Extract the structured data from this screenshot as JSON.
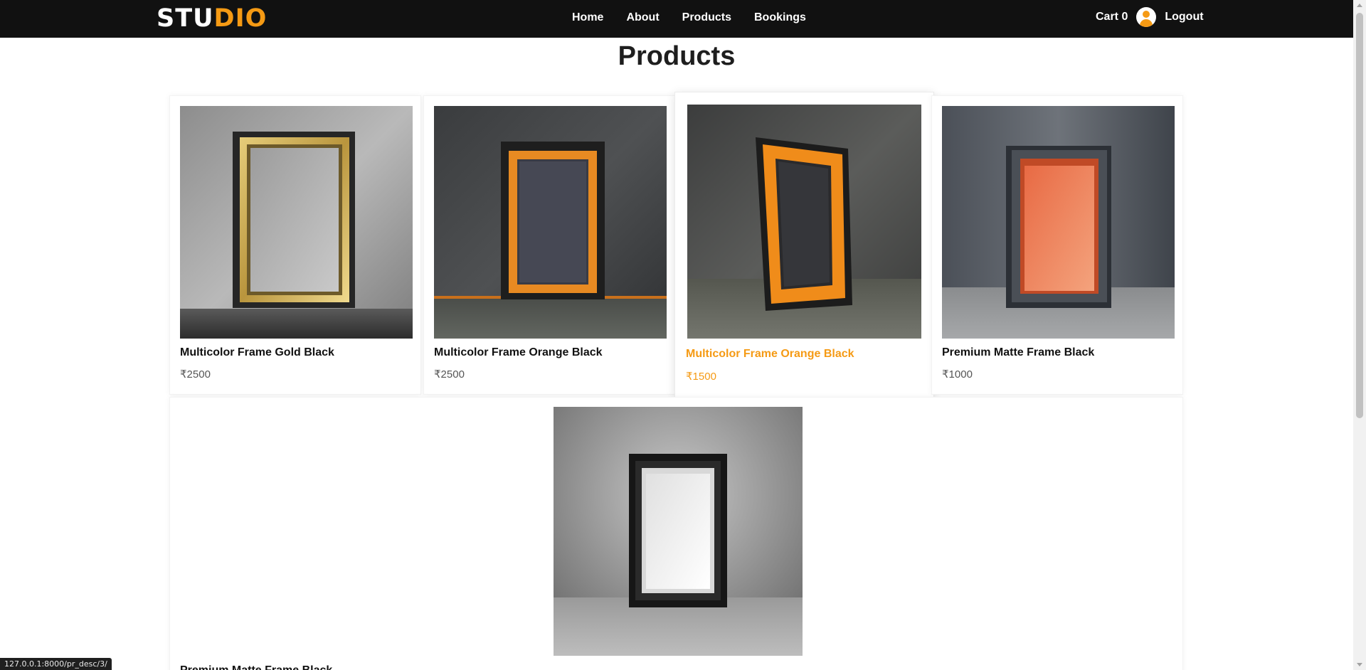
{
  "brand": {
    "part1": "STU",
    "part2": "DIO",
    "accent": "#f59a14"
  },
  "nav": {
    "links": [
      "Home",
      "About",
      "Products",
      "Bookings"
    ],
    "cart_label": "Cart 0",
    "logout_label": "Logout"
  },
  "page": {
    "title": "Products"
  },
  "products": [
    {
      "name": "Multicolor Frame Gold Black",
      "price": "₹2500"
    },
    {
      "name": "Multicolor Frame Orange Black",
      "price": "₹2500"
    },
    {
      "name": "Multicolor Frame Orange Black",
      "price": "₹1500"
    },
    {
      "name": "Premium Matte Frame Black",
      "price": "₹1000"
    },
    {
      "name": "Premium Matte Frame Black",
      "price": ""
    }
  ],
  "status_bar": {
    "url": "127.0.0.1:8000/pr_desc/3/"
  },
  "colors": {
    "navbar_bg": "#111111",
    "accent": "#f59a14",
    "page_bg": "#ffffff"
  }
}
